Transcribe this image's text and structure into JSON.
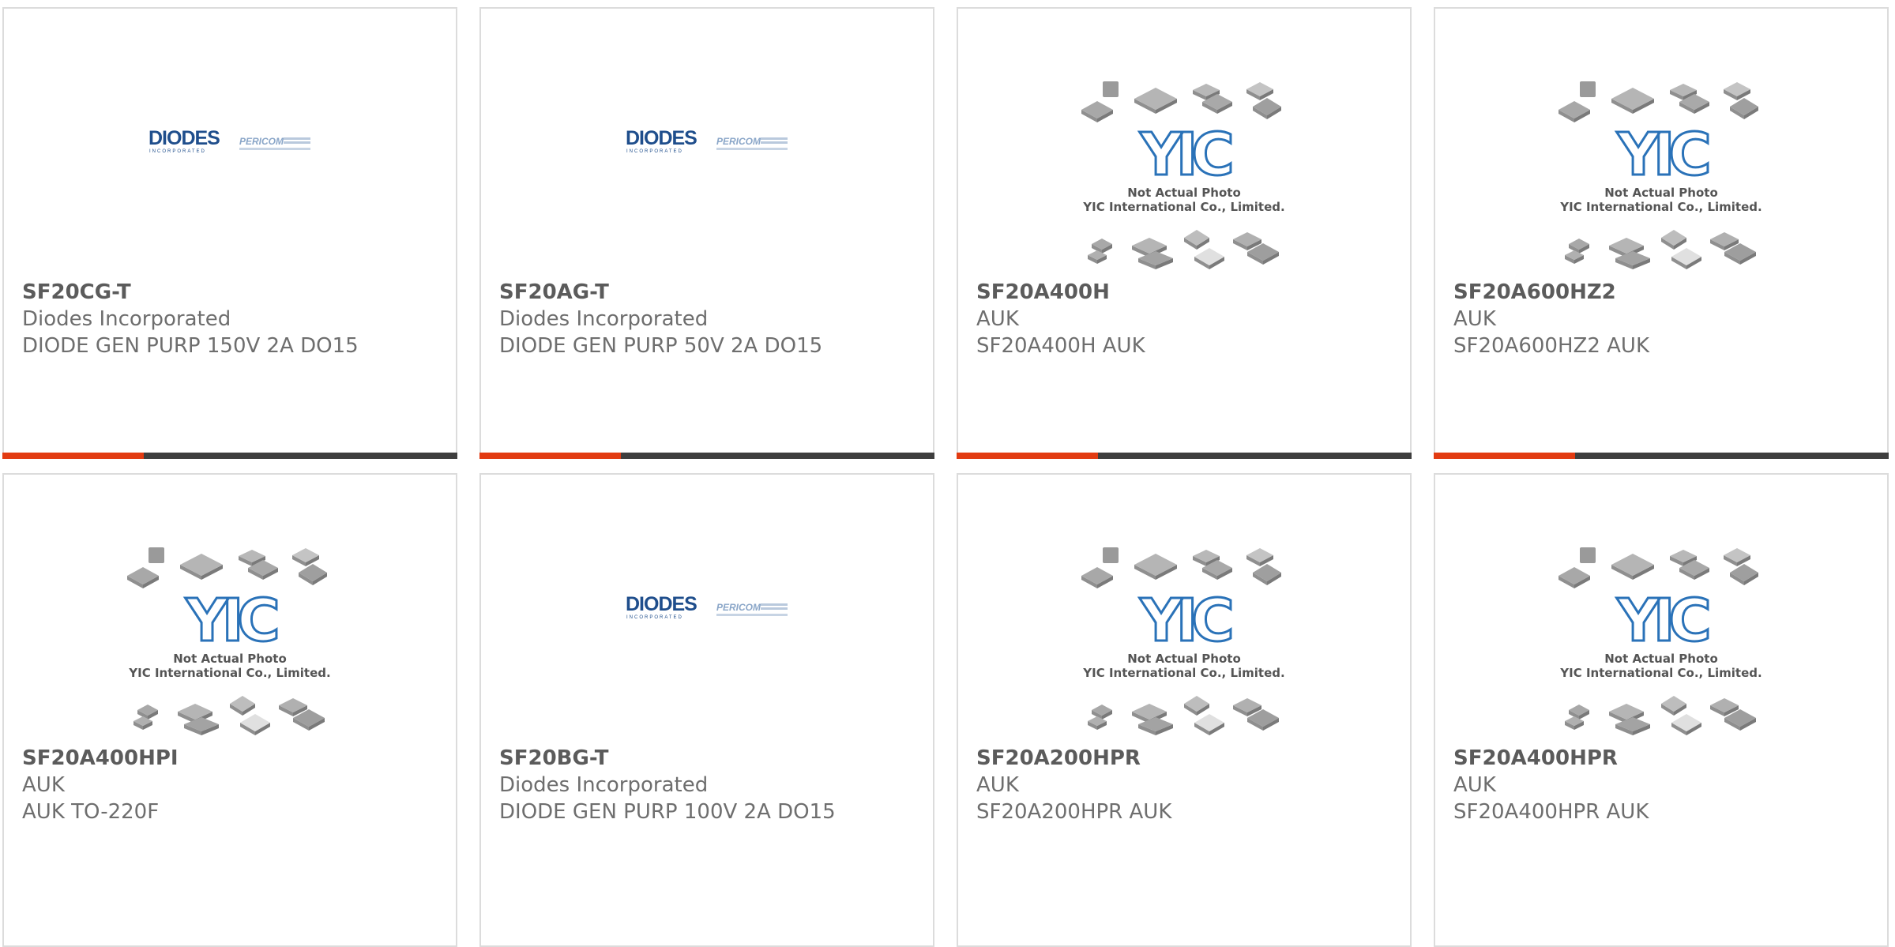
{
  "products": [
    {
      "part": "SF20CG-T",
      "manufacturer": "Diodes Incorporated",
      "description": "DIODE GEN PURP 150V 2A DO15",
      "image": "diodes-pericom-logo",
      "show_bar": true
    },
    {
      "part": "SF20AG-T",
      "manufacturer": "Diodes Incorporated",
      "description": "DIODE GEN PURP 50V 2A DO15",
      "image": "diodes-pericom-logo",
      "show_bar": true
    },
    {
      "part": "SF20A400H",
      "manufacturer": "AUK",
      "description": "SF20A400H AUK",
      "image": "yic-placeholder",
      "show_bar": true
    },
    {
      "part": "SF20A600HZ2",
      "manufacturer": "AUK",
      "description": "SF20A600HZ2 AUK",
      "image": "yic-placeholder",
      "show_bar": true
    },
    {
      "part": "SF20A400HPI",
      "manufacturer": "AUK",
      "description": "AUK TO-220F",
      "image": "yic-placeholder",
      "show_bar": false
    },
    {
      "part": "SF20BG-T",
      "manufacturer": "Diodes Incorporated",
      "description": "DIODE GEN PURP 100V 2A DO15",
      "image": "diodes-pericom-logo",
      "show_bar": false
    },
    {
      "part": "SF20A200HPR",
      "manufacturer": "AUK",
      "description": "SF20A200HPR AUK",
      "image": "yic-placeholder",
      "show_bar": false
    },
    {
      "part": "SF20A400HPR",
      "manufacturer": "AUK",
      "description": "SF20A400HPR AUK",
      "image": "yic-placeholder",
      "show_bar": false
    }
  ],
  "placeholder": {
    "line1": "Not Actual Photo",
    "line2": "YIC International Co., Limited.",
    "logo_text": "YIC"
  },
  "diodes_logo": {
    "brand": "DIODES",
    "tagline": "INCORPORATED",
    "partner": "PERICOM"
  },
  "colors": {
    "accent": "#e23b12",
    "bar": "#3e3e3e",
    "border": "#dcdcdc",
    "title": "#5b5b5b",
    "text": "#6e6e6e",
    "diodes_blue": "#1f4e8c",
    "yic_blue": "#2a72b8"
  },
  "bar_accent_fraction": 0.31
}
